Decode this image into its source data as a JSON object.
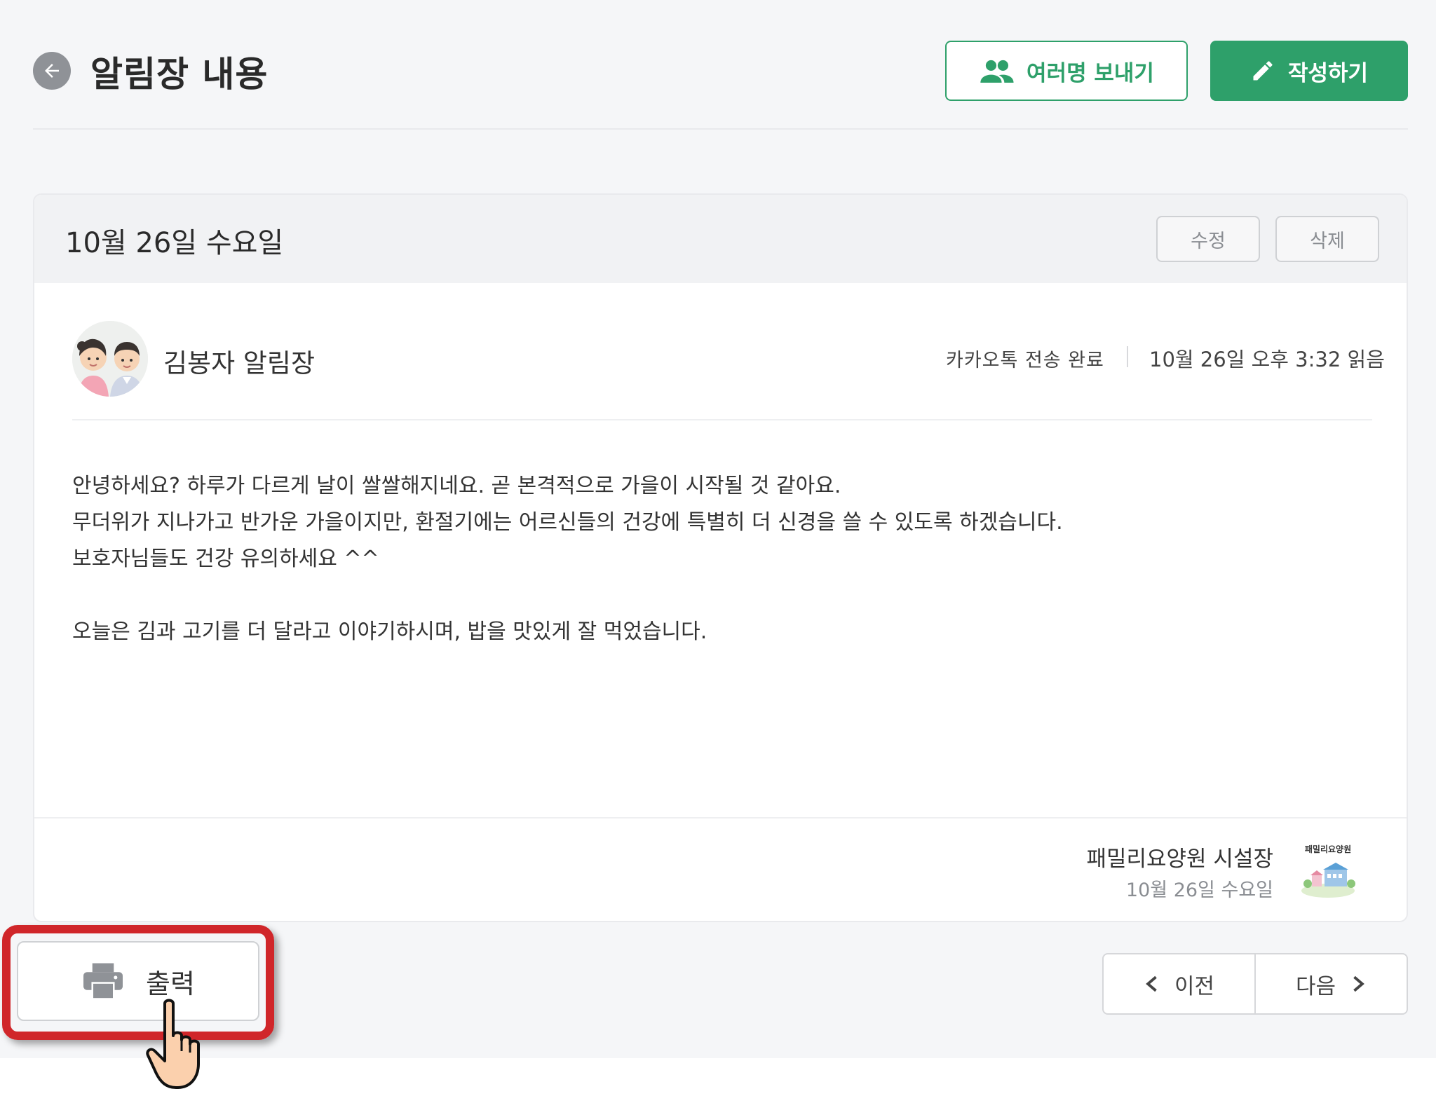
{
  "header": {
    "title": "알림장 내용",
    "multi_send_label": "여러명 보내기",
    "write_label": "작성하기"
  },
  "notice": {
    "date": "10월 26일 수요일",
    "edit_label": "수정",
    "delete_label": "삭제",
    "title": "김봉자 알림장",
    "kakao_status": "카카오톡 전송 완료",
    "read_time": "10월 26일 오후 3:32 읽음",
    "body": [
      "안녕하세요? 하루가 다르게 날이 쌀쌀해지네요. 곧 본격적으로 가을이 시작될 것 같아요.",
      "무더위가 지나가고 반가운 가을이지만, 환절기에는 어르신들의 건강에 특별히 더 신경을 쓸 수 있도록 하겠습니다.",
      "보호자님들도 건강 유의하세요 ^^",
      "",
      "오늘은 김과 고기를 더 달라고 이야기하시며, 밥을 맛있게 잘 먹었습니다."
    ],
    "signature_name": "패밀리요양원 시설장",
    "signature_date": "10월 26일 수요일",
    "logo_text": "패밀리요양원"
  },
  "actions": {
    "print_label": "출력",
    "prev_label": "이전",
    "next_label": "다음"
  },
  "colors": {
    "accent": "#2ea06a",
    "highlight": "#d0262a"
  }
}
